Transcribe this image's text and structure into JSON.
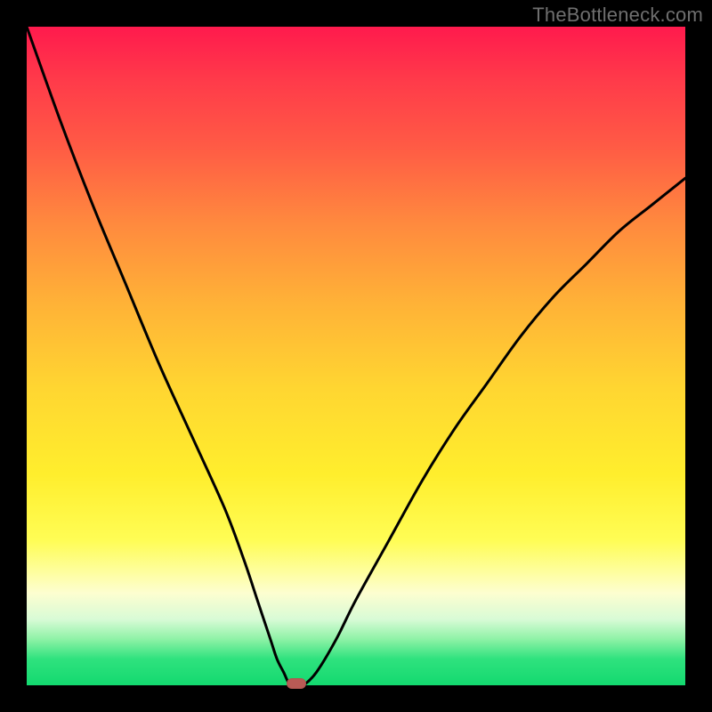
{
  "watermark": "TheBottleneck.com",
  "colors": {
    "frame": "#000000",
    "curve": "#000000",
    "marker": "#b85a55",
    "gradient_top": "#ff1a4d",
    "gradient_bottom": "#13d96f"
  },
  "chart_data": {
    "type": "line",
    "title": "",
    "xlabel": "",
    "ylabel": "",
    "xlim": [
      0,
      100
    ],
    "ylim": [
      0,
      100
    ],
    "grid": false,
    "legend": false,
    "annotations": [],
    "x": [
      0,
      5,
      10,
      15,
      20,
      25,
      30,
      33,
      35,
      37,
      38,
      39,
      40,
      41,
      42,
      44,
      47,
      50,
      55,
      60,
      65,
      70,
      75,
      80,
      85,
      90,
      95,
      100
    ],
    "y": [
      100,
      86,
      73,
      61,
      49,
      38,
      27,
      19,
      13,
      7,
      4,
      2,
      0,
      0,
      0,
      2,
      7,
      13,
      22,
      31,
      39,
      46,
      53,
      59,
      64,
      69,
      73,
      77
    ],
    "marker": {
      "x": 41,
      "y": 0
    },
    "notes": "V-shaped bottleneck curve; y is approximate percent mismatch, x is approximate position along component-ratio axis. No numeric tick labels are visible in the source image."
  }
}
